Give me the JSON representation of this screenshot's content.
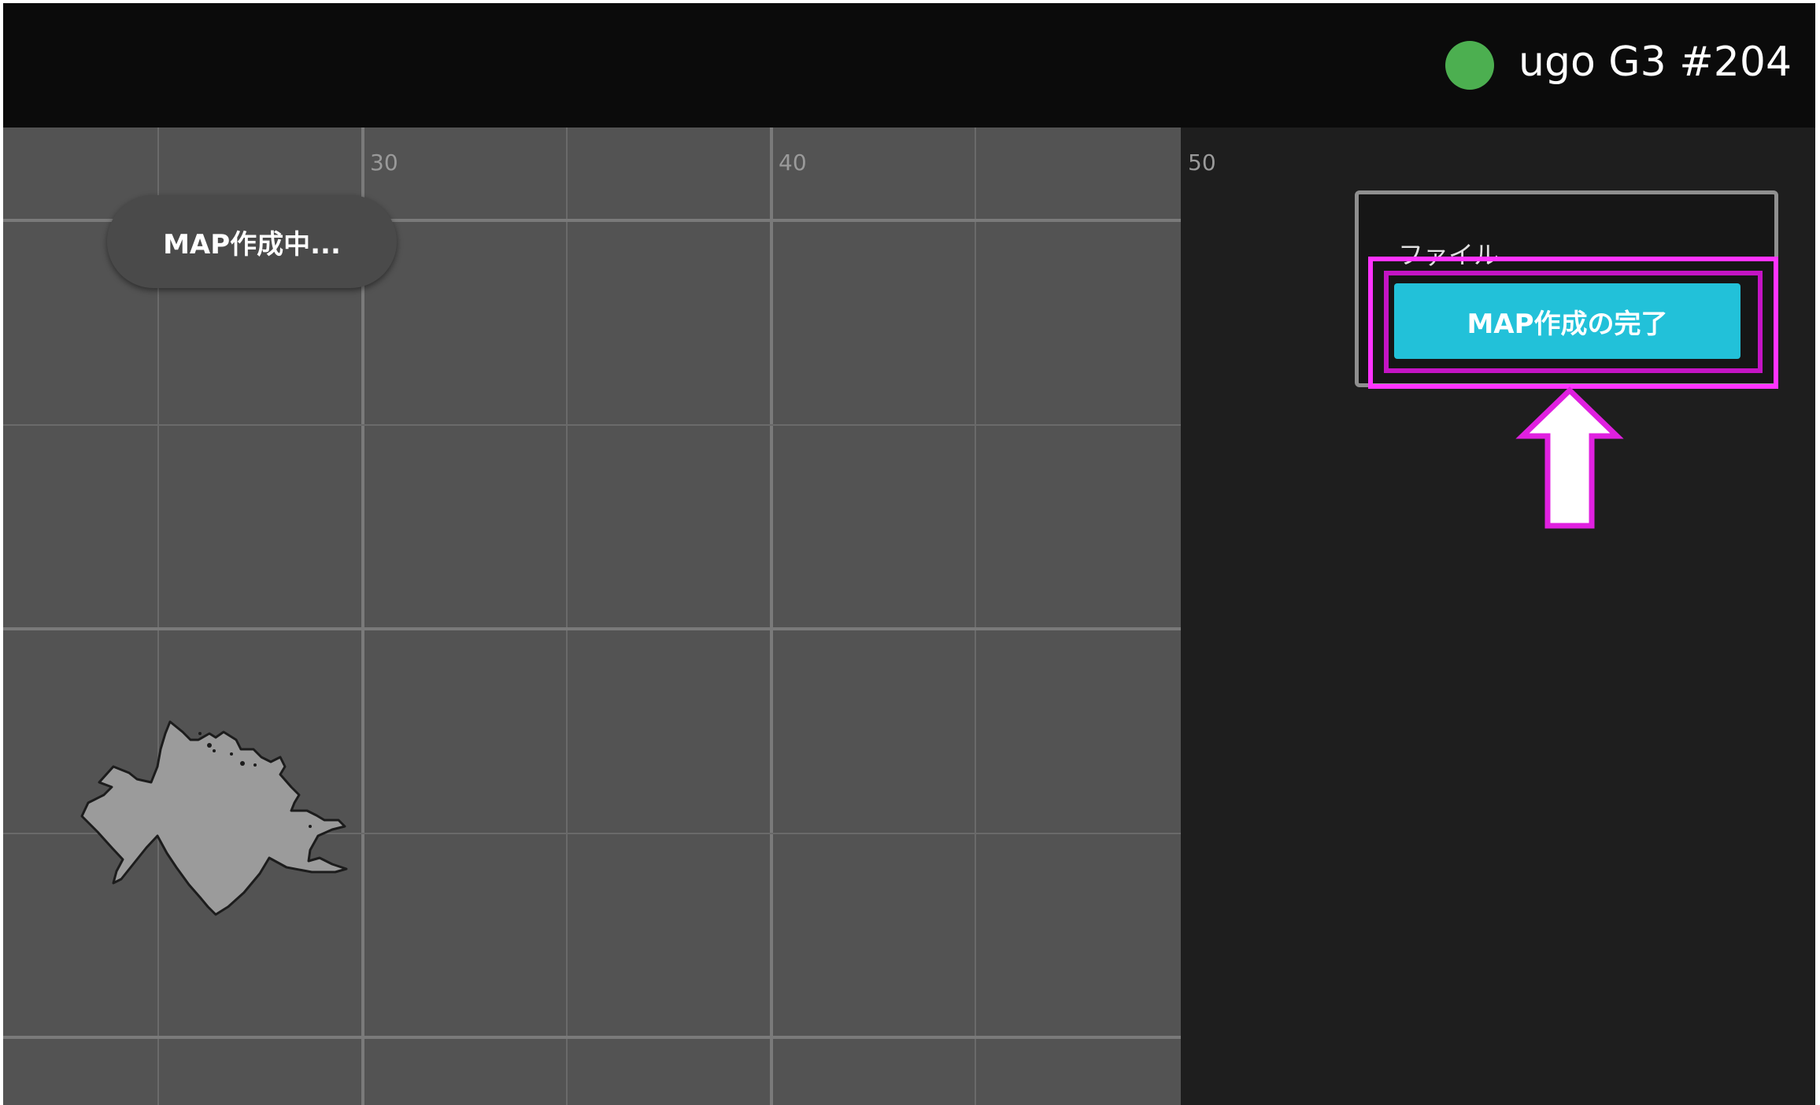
{
  "header": {
    "robot_name": "ugo G3 #204",
    "status_color": "#4caf50",
    "status_icon": "status-dot-icon"
  },
  "map": {
    "x_tick_labels": [
      "30",
      "40",
      "50"
    ],
    "status_label": "MAP作成中...",
    "grid_color": "#7a7a7a",
    "background_color": "#535353"
  },
  "menu": {
    "file_label": "ファイル",
    "finish_button_label": "MAP作成の完了",
    "accent_color": "#22c1d9"
  },
  "annotation": {
    "highlight_color": "#ff33ff",
    "arrow_icon": "up-arrow-icon"
  }
}
